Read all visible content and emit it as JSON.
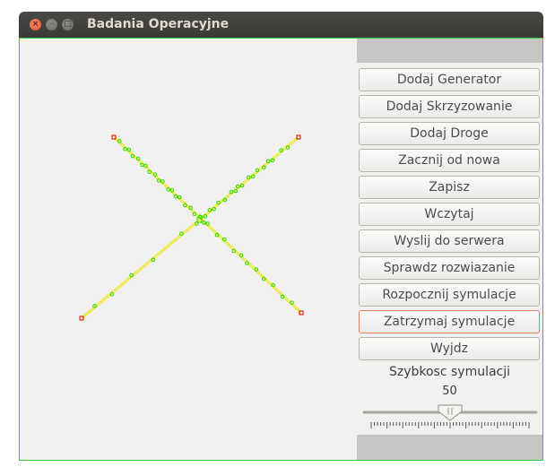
{
  "window": {
    "title": "Badania Operacyjne"
  },
  "buttons": [
    {
      "name": "dodaj-generator-button",
      "label": "Dodaj Generator"
    },
    {
      "name": "dodaj-skrzyzowanie-button",
      "label": "Dodaj Skrzyzowanie"
    },
    {
      "name": "dodaj-droge-button",
      "label": "Dodaj Droge"
    },
    {
      "name": "zacznij-od-nowa-button",
      "label": "Zacznij od nowa"
    },
    {
      "name": "zapisz-button",
      "label": "Zapisz"
    },
    {
      "name": "wczytaj-button",
      "label": "Wczytaj"
    },
    {
      "name": "wyslij-do-serwera-button",
      "label": "Wyslij do serwera"
    },
    {
      "name": "sprawdz-rozwiazanie-button",
      "label": "Sprawdz rozwiazanie"
    },
    {
      "name": "rozpocznij-symulacje-button",
      "label": "Rozpocznij symulacje"
    },
    {
      "name": "zatrzymaj-symulacje-button",
      "label": "Zatrzymaj symulacje",
      "focused": true
    },
    {
      "name": "wyjdz-button",
      "label": "Wyjdz"
    }
  ],
  "speed": {
    "label": "Szybkosc symulacji",
    "value": "50",
    "min": 0,
    "max": 100,
    "current": 50
  },
  "colors": {
    "road": "#e8e800",
    "vehicle": "#22dd00",
    "endpoint": "#dd0000",
    "border": "#2ecc40",
    "panel_gray": "#c5c5c5"
  }
}
